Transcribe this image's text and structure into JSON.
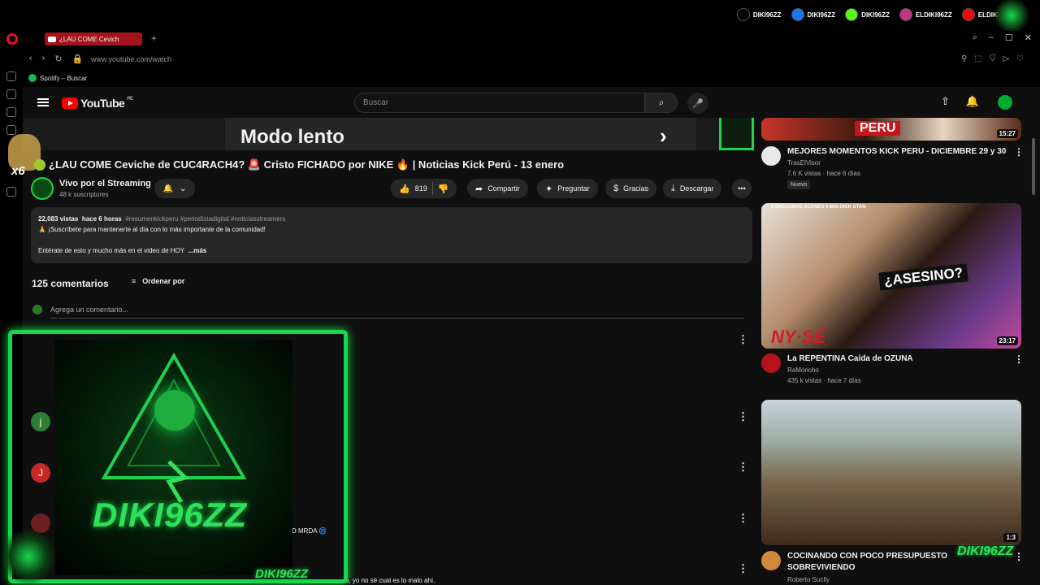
{
  "overlay": {
    "socials": [
      {
        "icon": "tiktok-icon",
        "handle": "DIKI96ZZ"
      },
      {
        "icon": "facebook-icon",
        "handle": "DIKI96ZZ"
      },
      {
        "icon": "kick-icon",
        "handle": "DIKI96ZZ"
      },
      {
        "icon": "instagram-icon",
        "handle": "ELDIKI96ZZ"
      },
      {
        "icon": "youtube-icon",
        "handle": "ELDIKI"
      }
    ],
    "brand": "DIKI96ZZ",
    "frame_label": "DIKI96ZZ",
    "multiplier": "x6",
    "accent_color": "#19d64a"
  },
  "browser": {
    "tab_title": "¿LAU COME Cevich",
    "new_tab": "+",
    "url": "www.youtube.com/watch",
    "bookmark": "Spotify – Buscar"
  },
  "youtube": {
    "logo": "YouTube",
    "region": "PE",
    "search_placeholder": "Buscar"
  },
  "player": {
    "overlay_text": "Modo lento",
    "next_icon": "›"
  },
  "video": {
    "title": "¿LAU COME Ceviche de CUC4RACH4? 🚨 Cristo FICHADO por NIKE 🔥 | Noticias Kick Perú - 13 enero",
    "channel": "Vivo por el Streaming",
    "subscribers": "48 k suscriptores",
    "likes": "819",
    "share": "Compartir",
    "ask": "Preguntar",
    "thanks": "Gracias",
    "download": "Descargar"
  },
  "description": {
    "views": "22,083 vistas",
    "time": "hace 6 horas",
    "tags": "#resumenkickperu #periodistadigital #noticiasstreamers",
    "line1": "🙏 ¡Suscríbete para mantenerte al día con lo más importante de la comunidad!",
    "line2": "Entérate de esto y mucho más en el video de HOY",
    "more": "...más"
  },
  "comments": {
    "count": "125 comentarios",
    "sort": "Ordenar por",
    "add_placeholder": "Agrega un comentario...",
    "avatars": [
      {
        "letter": "j",
        "color": "#2e7d32"
      },
      {
        "letter": "J",
        "color": "#c62828"
      }
    ],
    "snippet1": "D MRDA 🌀",
    "snippet2": "a, yo no sé cual es lo malo ahí."
  },
  "recommendations": [
    {
      "title": "MEJORES MOMENTOS KICK PERU - DICIEMBRE 29 y 30",
      "channel": "TrasElVisor",
      "meta": "7.6 K vistas · hace 6 días",
      "badge": "Nuevo",
      "duration": "15:27",
      "thumb_text": "PERU"
    },
    {
      "title": "La REPENTINA Caída de OZUNA",
      "channel": "RaMóncho",
      "meta": "435 k vistas · hace 7 días",
      "duration": "23:17",
      "thumb_text": "¿ASESINO?",
      "thumb_sub": "NY·SE",
      "thumb_top": "2 EXCLUSIVE SCENES 9 BIG DICK STAN"
    },
    {
      "title": "COCINANDO CON POCO PRESUPUESTO SOBREVIVIENDO",
      "channel": "Roberto Suclly",
      "duration": "1:3"
    }
  ]
}
